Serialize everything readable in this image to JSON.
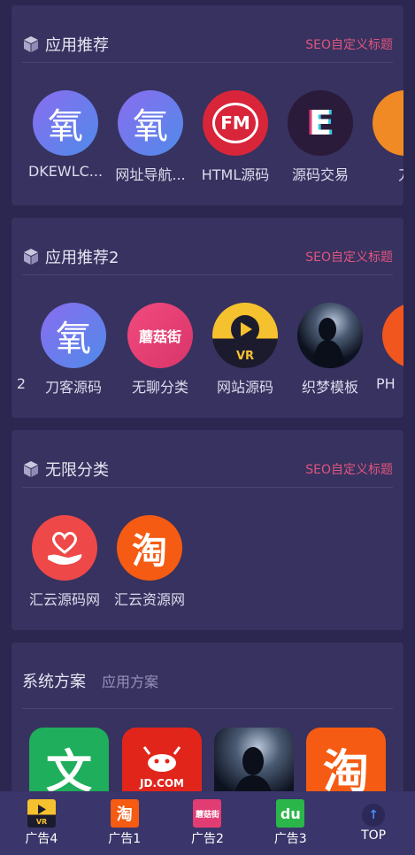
{
  "section1": {
    "title": "应用推荐",
    "seo_link": "SEO自定义标题",
    "items": [
      {
        "label": "DKEWLC...",
        "icon": "oxygen-logo-icon",
        "glyph": "氧"
      },
      {
        "label": "网址导航...",
        "icon": "oxygen-logo-icon",
        "glyph": "氧"
      },
      {
        "label": "HTML源码",
        "icon": "fm-headphones-icon",
        "glyph": "FM"
      },
      {
        "label": "源码交易",
        "icon": "glitch-logo-icon",
        "glyph": "E"
      },
      {
        "label": "刀",
        "icon": "partial-app-icon",
        "glyph": ""
      }
    ]
  },
  "section2": {
    "title": "应用推荐2",
    "seo_link": "SEO自定义标题",
    "items": [
      {
        "label": "2",
        "icon": "partial-app-icon",
        "glyph": ""
      },
      {
        "label": "刀客源码",
        "icon": "oxygen-logo-icon",
        "glyph": "氧"
      },
      {
        "label": "无聊分类",
        "icon": "mogujie-logo-icon",
        "glyph": "蘑菇街"
      },
      {
        "label": "网站源码",
        "icon": "vr-play-icon",
        "glyph": "VR"
      },
      {
        "label": "织梦模板",
        "icon": "silhouette-icon",
        "glyph": ""
      },
      {
        "label": "PH",
        "icon": "partial-app-icon",
        "glyph": ""
      }
    ]
  },
  "section3": {
    "title": "无限分类",
    "seo_link": "SEO自定义标题",
    "items": [
      {
        "label": "汇云源码网",
        "icon": "heart-hands-icon",
        "glyph": ""
      },
      {
        "label": "汇云资源网",
        "icon": "taobao-logo-icon",
        "glyph": "淘"
      }
    ]
  },
  "section4": {
    "tab_active": "系统方案",
    "tab_idle": "应用方案",
    "items": [
      {
        "icon": "wenku-logo-icon",
        "glyph": "文"
      },
      {
        "icon": "jd-logo-icon",
        "glyph": "JD.COM"
      },
      {
        "icon": "silhouette-icon",
        "glyph": ""
      },
      {
        "icon": "taobao-logo-icon",
        "glyph": "淘"
      }
    ]
  },
  "bottom_nav": [
    {
      "label": "广告4",
      "icon": "vr-play-icon"
    },
    {
      "label": "广告1",
      "icon": "taobao-logo-icon"
    },
    {
      "label": "广告2",
      "icon": "mogujie-logo-icon"
    },
    {
      "label": "广告3",
      "icon": "du-logo-icon"
    },
    {
      "label": "TOP",
      "icon": "arrow-up-icon"
    }
  ],
  "colors": {
    "background": "#2b2750",
    "card": "#37325f",
    "accent": "#e0557f"
  }
}
